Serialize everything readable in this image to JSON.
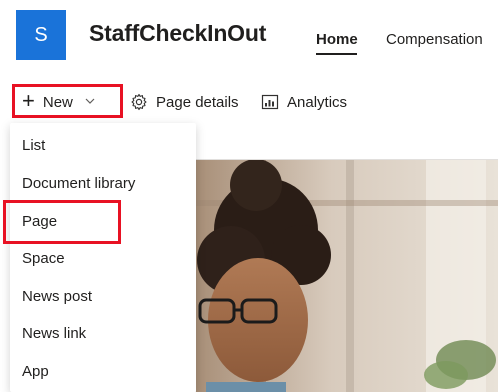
{
  "site": {
    "logo_letter": "S",
    "title": "StaffCheckInOut",
    "nav": {
      "home": "Home",
      "compensation": "Compensation"
    }
  },
  "commandbar": {
    "new_label": "New",
    "page_details_label": "Page details",
    "analytics_label": "Analytics"
  },
  "menu": {
    "items": [
      "List",
      "Document library",
      "Page",
      "Space",
      "News post",
      "News link",
      "App"
    ]
  },
  "colors": {
    "brand": "#1a73d9",
    "highlight": "#e81123"
  },
  "icons": {
    "new": "plus-icon",
    "new_dropdown": "chevron-down-icon",
    "page_details": "gear-icon",
    "analytics": "analytics-chart-icon"
  }
}
